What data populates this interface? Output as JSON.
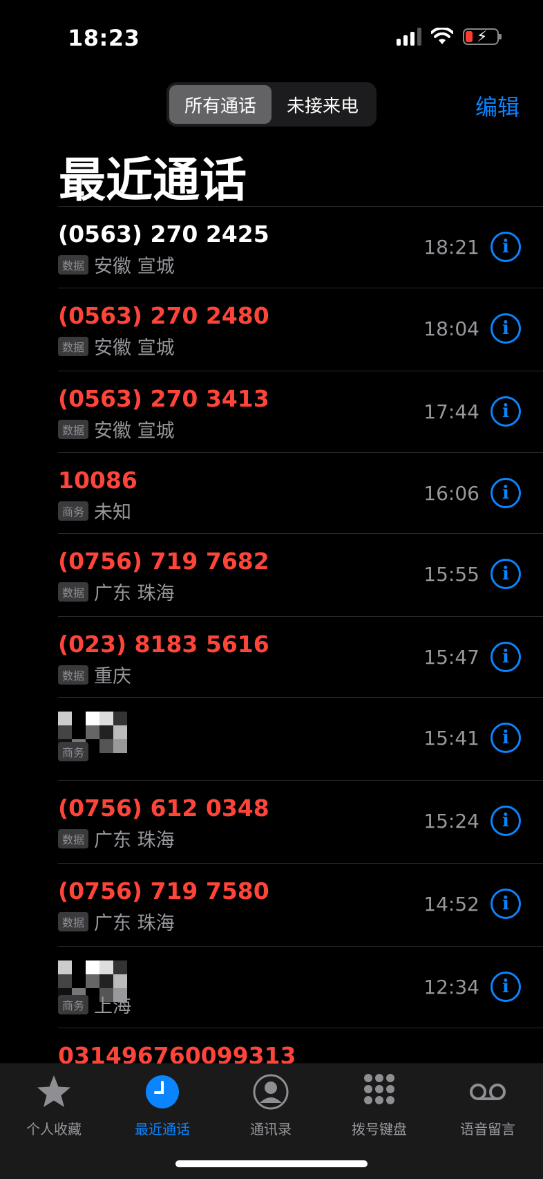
{
  "status": {
    "time": "18:23"
  },
  "segmented": {
    "all": "所有通话",
    "missed": "未接来电"
  },
  "edit_label": "编辑",
  "title": "最近通话",
  "calls": [
    {
      "name": "(0563) 270 2425",
      "tag": "数据",
      "location": "安徽 宣城",
      "time": "18:21",
      "missed": false
    },
    {
      "name": "(0563) 270 2480",
      "tag": "数据",
      "location": "安徽 宣城",
      "time": "18:04",
      "missed": true
    },
    {
      "name": "(0563) 270 3413",
      "tag": "数据",
      "location": "安徽 宣城",
      "time": "17:44",
      "missed": true
    },
    {
      "name": "10086",
      "tag": "商务",
      "location": "未知",
      "time": "16:06",
      "missed": true
    },
    {
      "name": "(0756) 719 7682",
      "tag": "数据",
      "location": "广东 珠海",
      "time": "15:55",
      "missed": true
    },
    {
      "name": "(023) 8183 5616",
      "tag": "数据",
      "location": "重庆",
      "time": "15:47",
      "missed": true
    },
    {
      "name": "",
      "tag": "商务",
      "location": "",
      "time": "15:41",
      "missed": false,
      "redacted": true
    },
    {
      "name": "(0756) 612 0348",
      "tag": "数据",
      "location": "广东 珠海",
      "time": "15:24",
      "missed": true
    },
    {
      "name": "(0756) 719 7580",
      "tag": "数据",
      "location": "广东 珠海",
      "time": "14:52",
      "missed": true
    },
    {
      "name": "",
      "tag": "商务",
      "location": "上海",
      "time": "12:34",
      "missed": false,
      "redacted": true
    },
    {
      "name": "031496760099313",
      "tag": "",
      "location": "",
      "time": "",
      "missed": true
    }
  ],
  "tabs": [
    {
      "label": "个人收藏",
      "icon": "star-icon"
    },
    {
      "label": "最近通话",
      "icon": "clock-icon"
    },
    {
      "label": "通讯录",
      "icon": "person-icon"
    },
    {
      "label": "拨号键盘",
      "icon": "keypad-icon"
    },
    {
      "label": "语音留言",
      "icon": "voicemail-icon"
    }
  ],
  "colors": {
    "accent": "#0a84ff",
    "missed": "#ff453a"
  }
}
